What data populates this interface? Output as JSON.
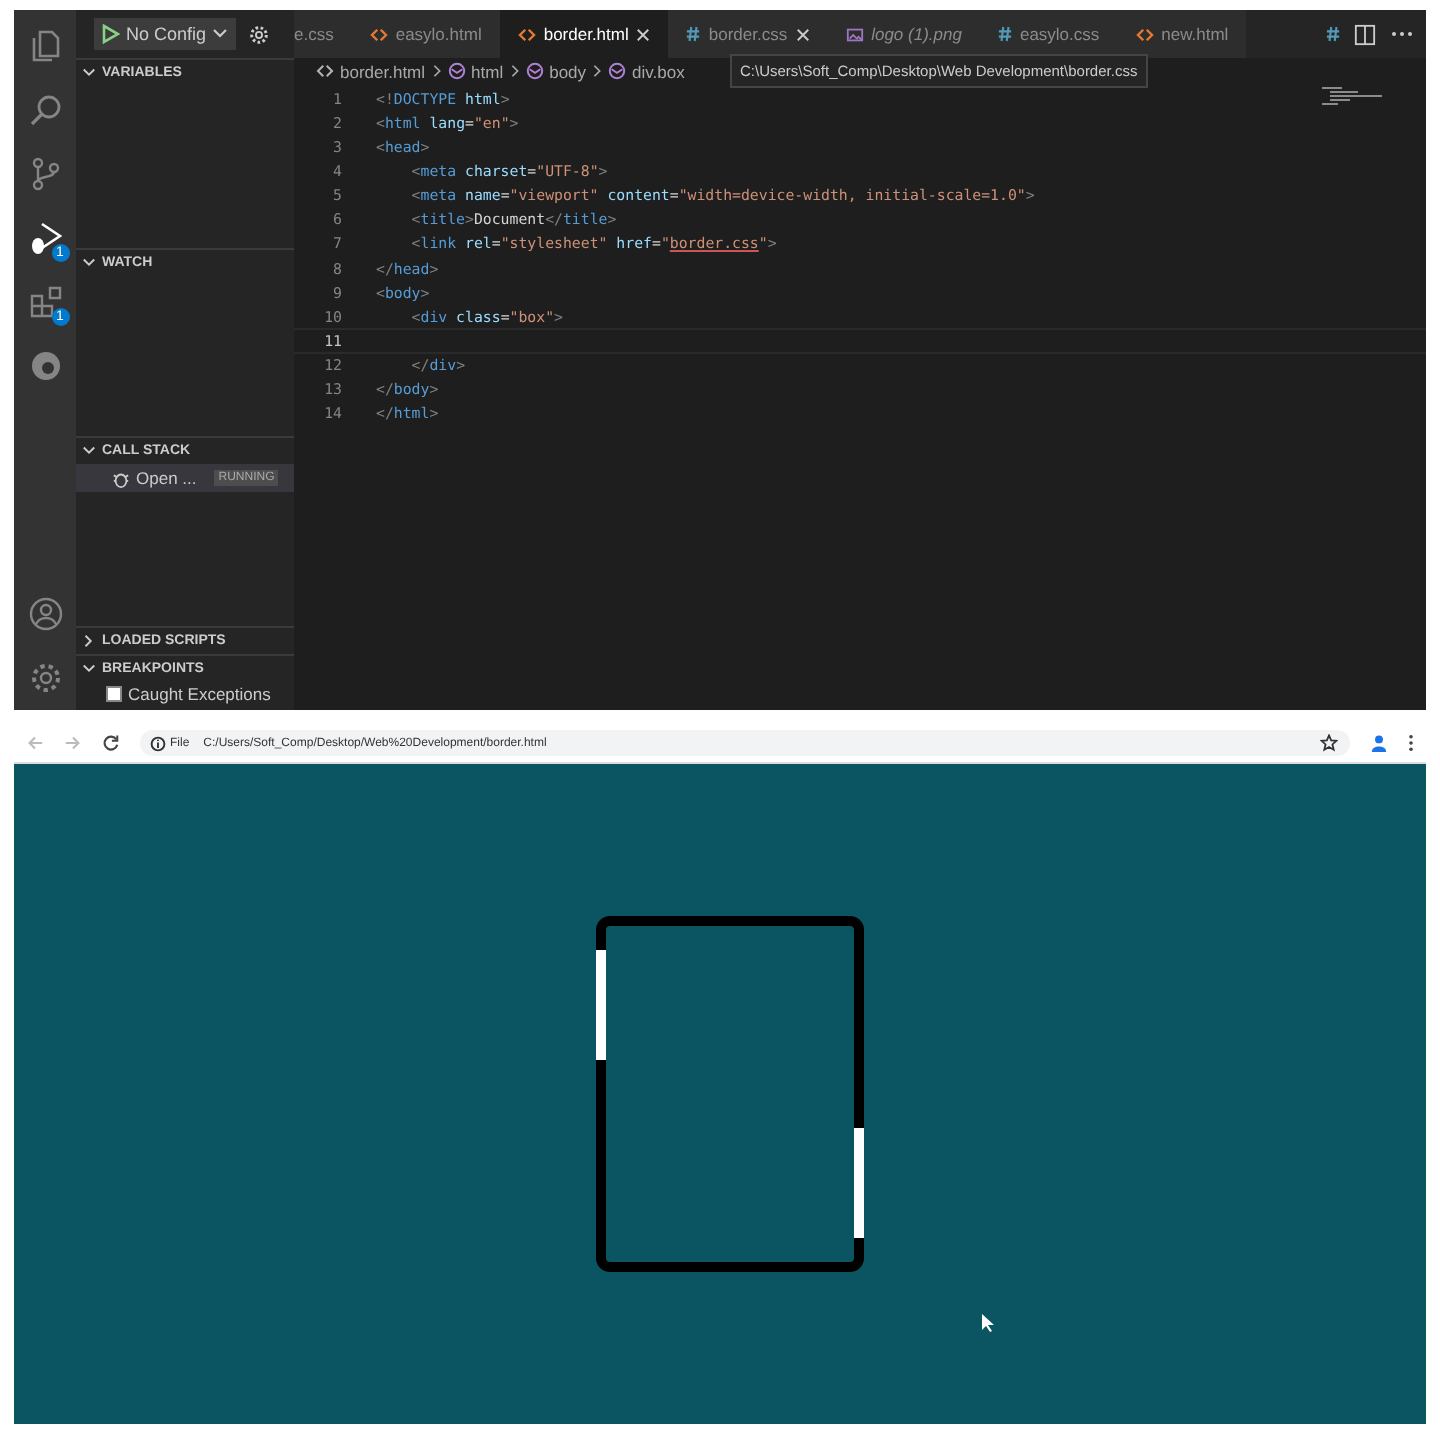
{
  "activity_bar": {
    "items": [
      {
        "kind": "files",
        "selected": false
      },
      {
        "kind": "search",
        "selected": false
      },
      {
        "kind": "source-control",
        "selected": false
      },
      {
        "kind": "debug",
        "selected": true,
        "badge": "1"
      },
      {
        "kind": "extensions",
        "selected": false,
        "badge": "1"
      },
      {
        "kind": "edge",
        "selected": false
      }
    ],
    "bottom": [
      {
        "kind": "account"
      },
      {
        "kind": "settings"
      }
    ]
  },
  "debug_toolbar": {
    "configuration": "No Config"
  },
  "tabs": [
    {
      "label": "e.css",
      "selected": false,
      "close": false,
      "italic": false,
      "cut": true
    },
    {
      "label": "easylo.html",
      "kind": "html",
      "selected": false,
      "close": false,
      "italic": false,
      "cut": false
    },
    {
      "label": "border.html",
      "kind": "html",
      "selected": true,
      "close": true,
      "italic": false,
      "cut": false
    },
    {
      "label": "border.css",
      "kind": "css",
      "selected": false,
      "close": true,
      "italic": false,
      "cut": false
    },
    {
      "label": "logo (1).png",
      "kind": "image",
      "selected": false,
      "close": false,
      "italic": true,
      "cut": false
    },
    {
      "label": "easylo.css",
      "kind": "css",
      "selected": false,
      "close": false,
      "italic": false,
      "cut": false
    },
    {
      "label": "new.html",
      "kind": "html",
      "selected": false,
      "close": false,
      "italic": false,
      "cut": false
    }
  ],
  "tooltip": "C:\\Users\\Soft_Comp\\Desktop\\Web Development\\border.css",
  "sidebar": {
    "sections": [
      {
        "title": "VARIABLES",
        "expanded": true
      },
      {
        "title": "WATCH",
        "expanded": true
      },
      {
        "title": "CALL STACK",
        "expanded": true,
        "items": [
          {
            "kind": "session",
            "label": "Open ...",
            "status": "RUNNING"
          }
        ]
      },
      {
        "title": "LOADED SCRIPTS",
        "expanded": false
      },
      {
        "title": "BREAKPOINTS",
        "expanded": true,
        "items": [
          {
            "kind": "checkbox",
            "label": "Caught Exceptions",
            "checked": false
          }
        ]
      }
    ]
  },
  "breadcrumbs": [
    "border.html",
    "html",
    "body",
    "div.box"
  ],
  "code": [
    {
      "number": "1",
      "current": false,
      "tokens": [
        {
          "kind": "punct",
          "text": "<!"
        },
        {
          "kind": "tag",
          "text": "DOCTYPE"
        },
        {
          "kind": "attr",
          "text": " html"
        },
        {
          "kind": "punct",
          "text": ">"
        }
      ]
    },
    {
      "number": "2",
      "current": false,
      "tokens": [
        {
          "kind": "punct",
          "text": "<"
        },
        {
          "kind": "tag",
          "text": "html"
        },
        {
          "kind": "attr",
          "text": " lang"
        },
        {
          "kind": "text",
          "text": "="
        },
        {
          "kind": "str",
          "text": "\"en\""
        },
        {
          "kind": "punct",
          "text": ">"
        }
      ]
    },
    {
      "number": "3",
      "current": false,
      "tokens": [
        {
          "kind": "punct",
          "text": "<"
        },
        {
          "kind": "tag",
          "text": "head"
        },
        {
          "kind": "punct",
          "text": ">"
        }
      ]
    },
    {
      "number": "4",
      "current": false,
      "tokens": [
        {
          "kind": "punct",
          "text": "    <"
        },
        {
          "kind": "tag",
          "text": "meta"
        },
        {
          "kind": "attr",
          "text": " charset"
        },
        {
          "kind": "text",
          "text": "="
        },
        {
          "kind": "str",
          "text": "\"UTF-8\""
        },
        {
          "kind": "punct",
          "text": ">"
        }
      ]
    },
    {
      "number": "5",
      "current": false,
      "tokens": [
        {
          "kind": "punct",
          "text": "    <"
        },
        {
          "kind": "tag",
          "text": "meta"
        },
        {
          "kind": "attr",
          "text": " name"
        },
        {
          "kind": "text",
          "text": "="
        },
        {
          "kind": "str",
          "text": "\"viewport\""
        },
        {
          "kind": "attr",
          "text": " content"
        },
        {
          "kind": "text",
          "text": "="
        },
        {
          "kind": "str",
          "text": "\"width=device-width, initial-scale=1.0\""
        },
        {
          "kind": "punct",
          "text": ">"
        }
      ]
    },
    {
      "number": "6",
      "current": false,
      "tokens": [
        {
          "kind": "punct",
          "text": "    <"
        },
        {
          "kind": "tag",
          "text": "title"
        },
        {
          "kind": "punct",
          "text": ">"
        },
        {
          "kind": "text",
          "text": "Document"
        },
        {
          "kind": "punct",
          "text": "</"
        },
        {
          "kind": "tag",
          "text": "title"
        },
        {
          "kind": "punct",
          "text": ">"
        }
      ]
    },
    {
      "number": "7",
      "current": false,
      "tokens": [
        {
          "kind": "punct",
          "text": "    <"
        },
        {
          "kind": "tag",
          "text": "link"
        },
        {
          "kind": "attr",
          "text": " rel"
        },
        {
          "kind": "text",
          "text": "="
        },
        {
          "kind": "str",
          "text": "\"stylesheet\""
        },
        {
          "kind": "attr",
          "text": " href"
        },
        {
          "kind": "text",
          "text": "="
        },
        {
          "kind": "str",
          "text": "\""
        },
        {
          "kind": "link",
          "text": "border.css"
        },
        {
          "kind": "str",
          "text": "\""
        },
        {
          "kind": "punct",
          "text": ">"
        }
      ]
    },
    {
      "number": "8",
      "current": false,
      "tokens": [
        {
          "kind": "punct",
          "text": "</"
        },
        {
          "kind": "tag",
          "text": "head"
        },
        {
          "kind": "punct",
          "text": ">"
        }
      ]
    },
    {
      "number": "9",
      "current": false,
      "tokens": [
        {
          "kind": "punct",
          "text": "<"
        },
        {
          "kind": "tag",
          "text": "body"
        },
        {
          "kind": "punct",
          "text": ">"
        }
      ]
    },
    {
      "number": "10",
      "current": false,
      "tokens": [
        {
          "kind": "punct",
          "text": "    <"
        },
        {
          "kind": "tag",
          "text": "div"
        },
        {
          "kind": "attr",
          "text": " class"
        },
        {
          "kind": "text",
          "text": "="
        },
        {
          "kind": "str",
          "text": "\"box\""
        },
        {
          "kind": "punct",
          "text": ">"
        }
      ]
    },
    {
      "number": "11",
      "current": true
    },
    {
      "number": "12",
      "current": false,
      "tokens": [
        {
          "kind": "punct",
          "text": "    </"
        },
        {
          "kind": "tag",
          "text": "div"
        },
        {
          "kind": "punct",
          "text": ">"
        }
      ]
    },
    {
      "number": "13",
      "current": false,
      "tokens": [
        {
          "kind": "punct",
          "text": "</"
        },
        {
          "kind": "tag",
          "text": "body"
        },
        {
          "kind": "punct",
          "text": ">"
        }
      ]
    },
    {
      "number": "14",
      "current": false,
      "tokens": [
        {
          "kind": "punct",
          "text": "</"
        },
        {
          "kind": "tag",
          "text": "html"
        },
        {
          "kind": "punct",
          "text": ">"
        }
      ]
    }
  ],
  "browser": {
    "scheme": "File",
    "url": "C:/Users/Soft_Comp/Desktop/Web%20Development/border.html"
  }
}
